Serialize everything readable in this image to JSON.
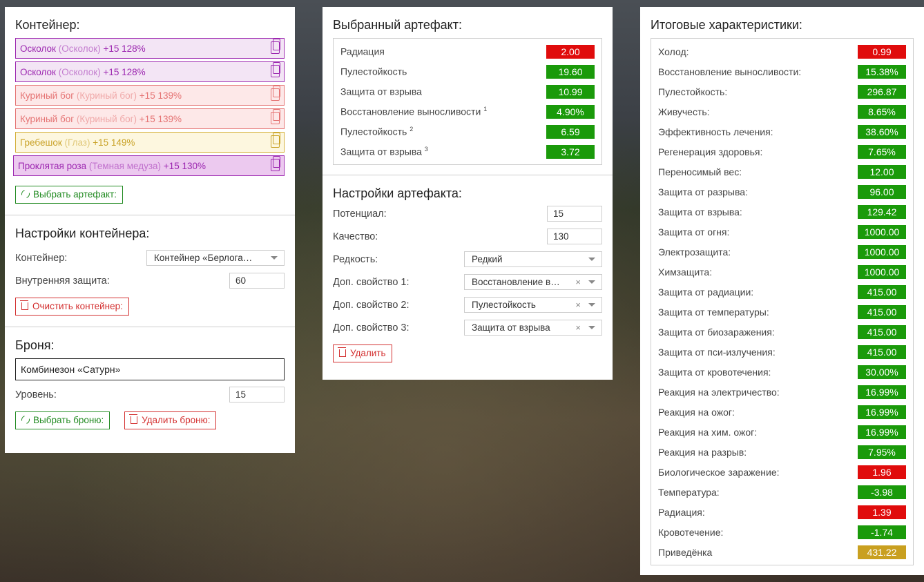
{
  "container_panel": {
    "title": "Контейнер:",
    "artifacts": [
      {
        "name": "Осколок",
        "base": "(Осколок)",
        "bonus": "+15 128%",
        "color": "#9c27b0"
      },
      {
        "name": "Осколок",
        "base": "(Осколок)",
        "bonus": "+15 128%",
        "color": "#9c27b0"
      },
      {
        "name": "Куриный бог",
        "base": "(Куриный бог)",
        "bonus": "+15 139%",
        "color": "#e57373"
      },
      {
        "name": "Куриный бог",
        "base": "(Куриный бог)",
        "bonus": "+15 139%",
        "color": "#e57373"
      },
      {
        "name": "Гребешок",
        "base": "(Глаз)",
        "bonus": "+15 149%",
        "color": "#c9a227"
      },
      {
        "name": "Проклятая роза",
        "base": "(Темная медуза)",
        "bonus": "+15 130%",
        "color": "#9c27b0"
      }
    ],
    "select_artifact_btn": "Выбрать артефакт:",
    "settings_title": "Настройки контейнера:",
    "container_label": "Контейнер:",
    "container_value": "Контейнер «Берлога…",
    "inner_protection_label": "Внутренняя защита:",
    "inner_protection_value": "60",
    "clear_btn": "Очистить контейнер:",
    "armor_title": "Броня:",
    "armor_value": "Комбинезон «Сатурн»",
    "level_label": "Уровень:",
    "level_value": "15",
    "select_armor_btn": "Выбрать броню:",
    "delete_armor_btn": "Удалить броню:"
  },
  "artifact_panel": {
    "title": "Выбранный артефакт:",
    "stats": [
      {
        "label": "Радиация",
        "sup": "",
        "value": "2.00",
        "status": "red"
      },
      {
        "label": "Пулестойкость",
        "sup": "",
        "value": "19.60",
        "status": "green"
      },
      {
        "label": "Защита от взрыва",
        "sup": "",
        "value": "10.99",
        "status": "green"
      },
      {
        "label": "Восстановление выносливости",
        "sup": "1",
        "value": "4.90%",
        "status": "green"
      },
      {
        "label": "Пулестойкость",
        "sup": "2",
        "value": "6.59",
        "status": "green"
      },
      {
        "label": "Защита от взрыва",
        "sup": "3",
        "value": "3.72",
        "status": "green"
      }
    ],
    "settings_title": "Настройки артефакта:",
    "potential_label": "Потенциал:",
    "potential_value": "15",
    "quality_label": "Качество:",
    "quality_value": "130",
    "rarity_label": "Редкость:",
    "rarity_value": "Редкий",
    "extra1_label": "Доп. свойство 1:",
    "extra1_value": "Восстановление в…",
    "extra2_label": "Доп. свойство 2:",
    "extra2_value": "Пулестойкость",
    "extra3_label": "Доп. свойство 3:",
    "extra3_value": "Защита от взрыва",
    "clear_symbol": "×",
    "delete_btn": "Удалить"
  },
  "totals_panel": {
    "title": "Итоговые характеристики:",
    "stats": [
      {
        "label": "Холод:",
        "value": "0.99",
        "status": "red"
      },
      {
        "label": "Восстановление выносливости:",
        "value": "15.38%",
        "status": "green"
      },
      {
        "label": "Пулестойкость:",
        "value": "296.87",
        "status": "green"
      },
      {
        "label": "Живучесть:",
        "value": "8.65%",
        "status": "green"
      },
      {
        "label": "Эффективность лечения:",
        "value": "38.60%",
        "status": "green"
      },
      {
        "label": "Регенерация здоровья:",
        "value": "7.65%",
        "status": "green"
      },
      {
        "label": "Переносимый вес:",
        "value": "12.00",
        "status": "green"
      },
      {
        "label": "Защита от разрыва:",
        "value": "96.00",
        "status": "green"
      },
      {
        "label": "Защита от взрыва:",
        "value": "129.42",
        "status": "green"
      },
      {
        "label": "Защита от огня:",
        "value": "1000.00",
        "status": "green"
      },
      {
        "label": "Электрозащита:",
        "value": "1000.00",
        "status": "green"
      },
      {
        "label": "Химзащита:",
        "value": "1000.00",
        "status": "green"
      },
      {
        "label": "Защита от радиации:",
        "value": "415.00",
        "status": "green"
      },
      {
        "label": "Защита от температуры:",
        "value": "415.00",
        "status": "green"
      },
      {
        "label": "Защита от биозаражения:",
        "value": "415.00",
        "status": "green"
      },
      {
        "label": "Защита от пси-излучения:",
        "value": "415.00",
        "status": "green"
      },
      {
        "label": "Защита от кровотечения:",
        "value": "30.00%",
        "status": "green"
      },
      {
        "label": "Реакция на электричество:",
        "value": "16.99%",
        "status": "green"
      },
      {
        "label": "Реакция на ожог:",
        "value": "16.99%",
        "status": "green"
      },
      {
        "label": "Реакция на хим. ожог:",
        "value": "16.99%",
        "status": "green"
      },
      {
        "label": "Реакция на разрыв:",
        "value": "7.95%",
        "status": "green"
      },
      {
        "label": "Биологическое заражение:",
        "value": "1.96",
        "status": "red"
      },
      {
        "label": "Температура:",
        "value": "-3.98",
        "status": "green"
      },
      {
        "label": "Радиация:",
        "value": "1.39",
        "status": "red"
      },
      {
        "label": "Кровотечение:",
        "value": "-1.74",
        "status": "green"
      },
      {
        "label": "Приведёнка",
        "value": "431.22",
        "status": "gold"
      }
    ]
  }
}
